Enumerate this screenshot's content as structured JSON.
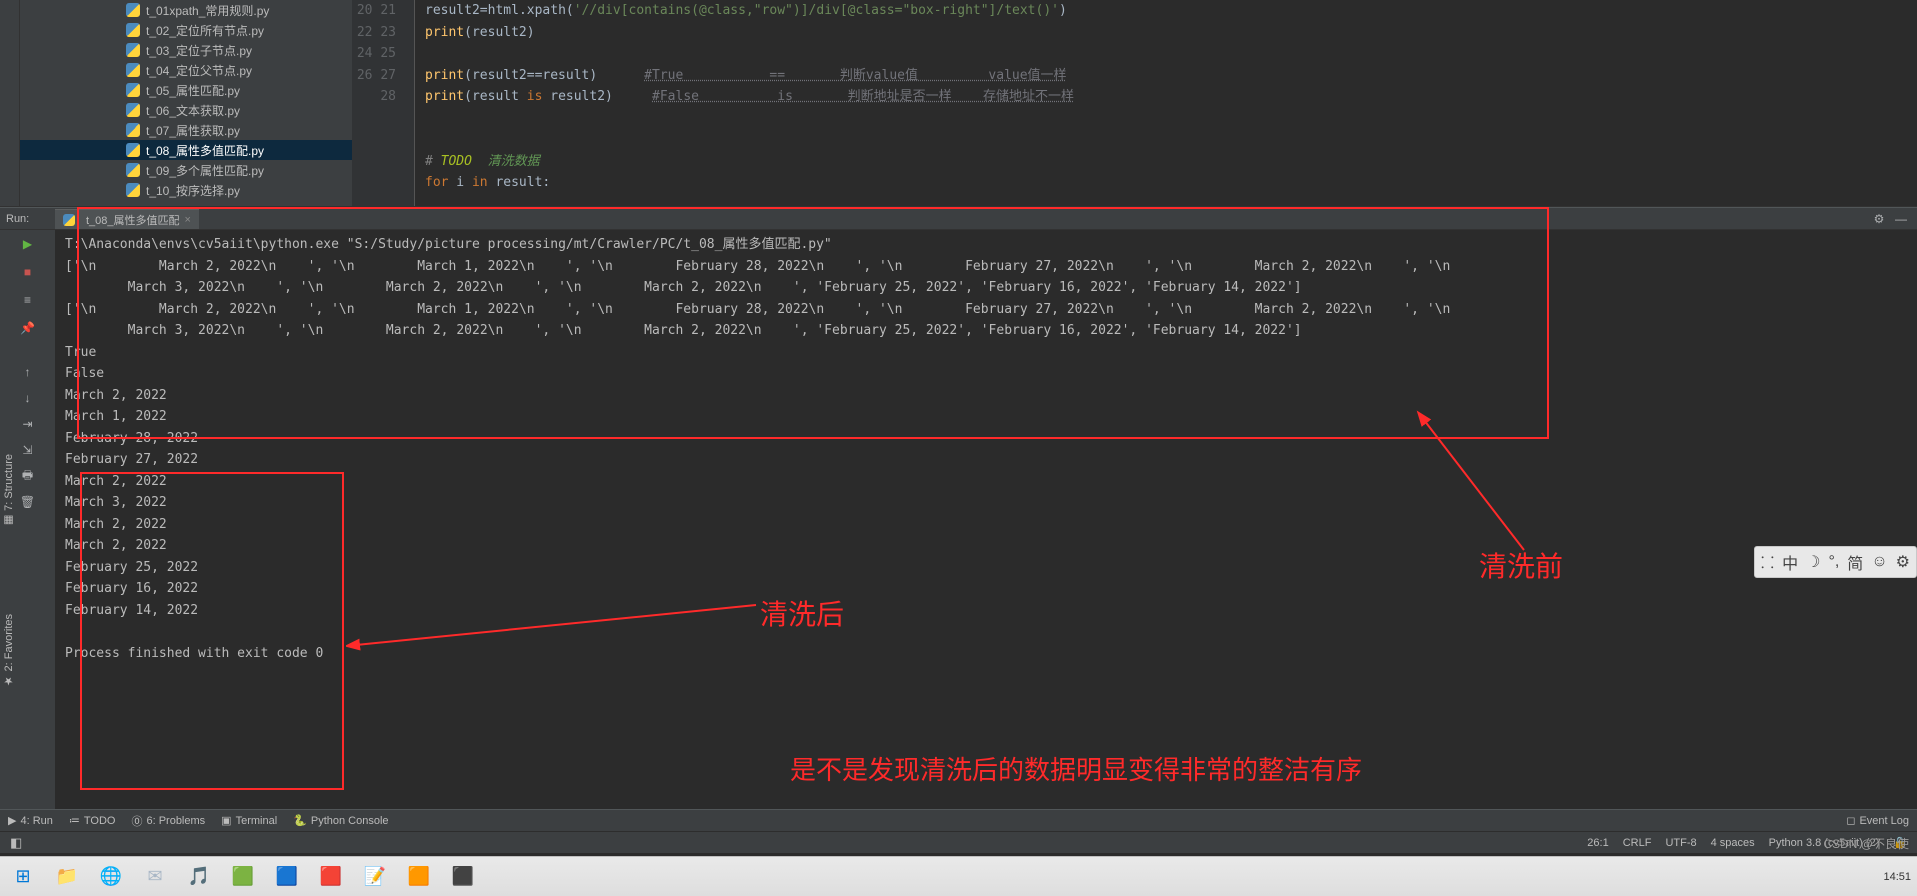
{
  "tree": {
    "files": [
      "t_01xpath_常用规则.py",
      "t_02_定位所有节点.py",
      "t_03_定位子节点.py",
      "t_04_定位父节点.py",
      "t_05_属性匹配.py",
      "t_06_文本获取.py",
      "t_07_属性获取.py",
      "t_08_属性多值匹配.py",
      "t_09_多个属性匹配.py",
      "t_10_按序选择.py"
    ],
    "selected_index": 7
  },
  "editor": {
    "line_start": 20,
    "lines": {
      "l20_a": "result2",
      "l20_b": "=html",
      "l20_c": ".xpath(",
      "l20_str": "'//div[contains(@class,\"row\")]/div[@class=\"box-right\"]/text()'",
      "l20_d": ")",
      "l21": "print",
      "l21_arg": "(result2)",
      "l23": "print",
      "l23_arg": "(result2==result)",
      "l23_cmt": "#True           ==       判断value值         value值一样",
      "l24": "print",
      "l24_arg_open": "(result ",
      "l24_is": "is",
      "l24_arg_close": " result2)",
      "l24_cmt": "#False          is       判断地址是否一样    存储地址不一样",
      "l27_hash": "# ",
      "l27_todo": "TODO",
      "l27_rest": "  清洗数据",
      "l28_for": "for",
      "l28_i": " i ",
      "l28_in": "in",
      "l28_r": " result:"
    }
  },
  "run": {
    "label": "Run:",
    "tab": "t_08_属性多值匹配",
    "output": {
      "cmd": "T:\\Anaconda\\envs\\cv5aiit\\python.exe \"S:/Study/picture processing/mt/Crawler/PC/t_08_属性多值匹配.py\"",
      "arr1a": "['\\n        March 2, 2022\\n    ', '\\n        March 1, 2022\\n    ', '\\n        February 28, 2022\\n    ', '\\n        February 27, 2022\\n    ', '\\n        March 2, 2022\\n    ', '\\n",
      "arr1b": "        March 3, 2022\\n    ', '\\n        March 2, 2022\\n    ', '\\n        March 2, 2022\\n    ', 'February 25, 2022', 'February 16, 2022', 'February 14, 2022']",
      "arr2a": "['\\n        March 2, 2022\\n    ', '\\n        March 1, 2022\\n    ', '\\n        February 28, 2022\\n    ', '\\n        February 27, 2022\\n    ', '\\n        March 2, 2022\\n    ', '\\n",
      "arr2b": "        March 3, 2022\\n    ', '\\n        March 2, 2022\\n    ', '\\n        March 2, 2022\\n    ', 'February 25, 2022', 'February 16, 2022', 'February 14, 2022']",
      "true": "True",
      "false": "False",
      "cleaned": [
        "March 2, 2022",
        "March 1, 2022",
        "February 28, 2022",
        "February 27, 2022",
        "March 2, 2022",
        "March 3, 2022",
        "March 2, 2022",
        "March 2, 2022",
        "February 25, 2022",
        "February 16, 2022",
        "February 14, 2022"
      ],
      "exit": "Process finished with exit code 0"
    }
  },
  "side_tabs": {
    "structure": "7: Structure",
    "favorites": "2: Favorites"
  },
  "bottom": {
    "run": "4: Run",
    "todo": "TODO",
    "problems": "6: Problems",
    "terminal": "Terminal",
    "console": "Python Console",
    "eventlog": "Event Log"
  },
  "status": {
    "pos": "26:1",
    "eol": "CRLF",
    "enc": "UTF-8",
    "indent": "4 spaces",
    "python": "Python 3.8 (cv5aiit) (2)"
  },
  "annotations": {
    "before": "清洗前",
    "after": "清洗后",
    "bottom": "是不是发现清洗后的数据明显变得非常的整洁有序"
  },
  "ime": {
    "zhong": "中",
    "jian": "简"
  },
  "taskbar": {
    "time": "14:51"
  },
  "watermark": "CSDN @不良使"
}
